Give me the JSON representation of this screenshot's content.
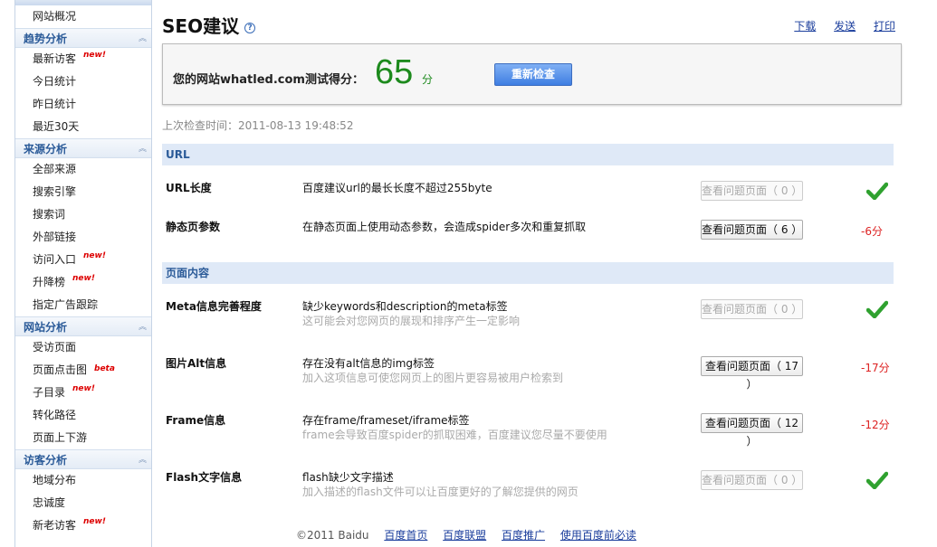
{
  "sidebar": {
    "items": [
      {
        "type": "item",
        "label": "网站概况"
      },
      {
        "type": "group",
        "label": "趋势分析"
      },
      {
        "type": "item",
        "label": "最新访客",
        "badge": "new!"
      },
      {
        "type": "item",
        "label": "今日统计"
      },
      {
        "type": "item",
        "label": "昨日统计"
      },
      {
        "type": "item",
        "label": "最近30天"
      },
      {
        "type": "group",
        "label": "来源分析"
      },
      {
        "type": "item",
        "label": "全部来源"
      },
      {
        "type": "item",
        "label": "搜索引擎"
      },
      {
        "type": "item",
        "label": "搜索词"
      },
      {
        "type": "item",
        "label": "外部链接"
      },
      {
        "type": "item",
        "label": "访问入口",
        "badge": "new!"
      },
      {
        "type": "item",
        "label": "升降榜",
        "badge": "new!"
      },
      {
        "type": "item",
        "label": "指定广告跟踪"
      },
      {
        "type": "group",
        "label": "网站分析"
      },
      {
        "type": "item",
        "label": "受访页面"
      },
      {
        "type": "item",
        "label": "页面点击图",
        "beta": "beta"
      },
      {
        "type": "item",
        "label": "子目录",
        "badge": "new!"
      },
      {
        "type": "item",
        "label": "转化路径"
      },
      {
        "type": "item",
        "label": "页面上下游"
      },
      {
        "type": "group",
        "label": "访客分析"
      },
      {
        "type": "item",
        "label": "地域分布"
      },
      {
        "type": "item",
        "label": "忠诚度"
      },
      {
        "type": "item",
        "label": "新老访客",
        "badge": "new!"
      }
    ]
  },
  "header": {
    "title": "SEO建议",
    "help_icon": "?",
    "links": [
      "下载",
      "发送",
      "打印"
    ]
  },
  "score": {
    "label": "您的网站whatled.com测试得分：",
    "value": "65",
    "unit": "分",
    "recheck": "重新检查"
  },
  "last_check": "上次检查时间：2011-08-13 19:48:52",
  "sections": {
    "url": {
      "title": "URL",
      "rows": [
        {
          "name": "URL长度",
          "desc": "百度建议url的最长长度不超过255byte",
          "sub": "",
          "button": "查看问题页面（ 0 ）",
          "status": "pass"
        },
        {
          "name": "静态页参数",
          "desc": "在静态页面上使用动态参数，会造成spider多次和重复抓取",
          "sub": "",
          "button": "查看问题页面（ 6 ）",
          "status": "-6分"
        }
      ]
    },
    "content": {
      "title": "页面内容",
      "rows": [
        {
          "name": "Meta信息完善程度",
          "desc": "缺少keywords和description的meta标签",
          "sub": "这可能会对您网页的展现和排序产生一定影响",
          "button": "查看问题页面（ 0 ）",
          "status": "pass"
        },
        {
          "name": "图片Alt信息",
          "desc": "存在没有alt信息的img标签",
          "sub": "加入这项信息可使您网页上的图片更容易被用户检索到",
          "button": "查看问题页面（ 17 ）",
          "status": "-17分"
        },
        {
          "name": "Frame信息",
          "desc": "存在frame/frameset/iframe标签",
          "sub": "frame会导致百度spider的抓取困难，百度建议您尽量不要使用",
          "button": "查看问题页面（ 12 ）",
          "status": "-12分"
        },
        {
          "name": "Flash文字信息",
          "desc": "flash缺少文字描述",
          "sub": "加入描述的flash文件可以让百度更好的了解您提供的网页",
          "button": "查看问题页面（ 0 ）",
          "status": "pass"
        }
      ]
    }
  },
  "footer": {
    "copyright": "©2011 Baidu",
    "links": [
      "百度首页",
      "百度联盟",
      "百度推广",
      "使用百度前必读"
    ]
  },
  "colors": {
    "accent": "#2a5a98",
    "score": "#1d8a1d",
    "penalty": "#dd2222"
  }
}
